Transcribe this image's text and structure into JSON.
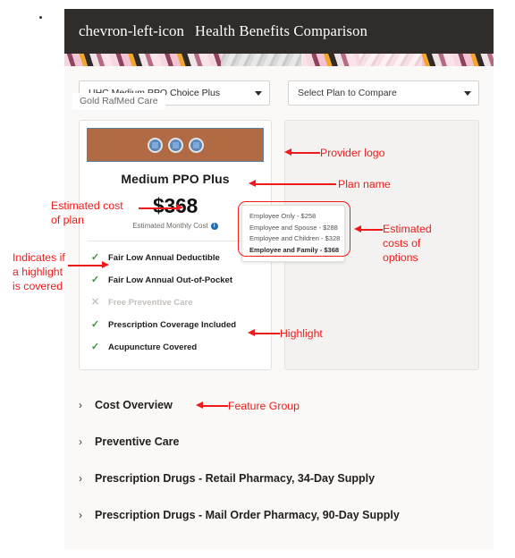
{
  "header": {
    "back_icon": "chevron-left-icon",
    "title": "Health Benefits Comparison"
  },
  "selectors": {
    "plan_select": {
      "value": "UHC Medium PPO Choice Plus",
      "tooltip": "Gold RafMed Care",
      "caret_icon": "chevron-down-icon"
    },
    "compare_select": {
      "placeholder": "Select Plan to Compare",
      "caret_icon": "chevron-down-icon"
    }
  },
  "plan_card": {
    "provider_logo_alt": "provider-logo",
    "plan_name": "Medium PPO Plus",
    "price": "$368",
    "price_caption": "Estimated Monthly Cost",
    "info_icon": "info-icon",
    "features": [
      {
        "label": "Fair Low Annual Deductible",
        "covered": true,
        "mark": "✓"
      },
      {
        "label": "Fair Low Annual Out-of-Pocket",
        "covered": true,
        "mark": "✓"
      },
      {
        "label": "Free Preventive Care",
        "covered": false,
        "mark": "✕"
      },
      {
        "label": "Prescription Coverage Included",
        "covered": true,
        "mark": "✓"
      },
      {
        "label": "Acupuncture Covered",
        "covered": true,
        "mark": "✓"
      }
    ]
  },
  "cost_popup": {
    "options": [
      {
        "label": "Employee Only - $258",
        "bold": false
      },
      {
        "label": "Employee and Spouse - $288",
        "bold": false
      },
      {
        "label": "Employee and Children - $328",
        "bold": false
      },
      {
        "label": "Employee and Family - $368",
        "bold": true
      }
    ]
  },
  "accordion": {
    "chevron_icon": "chevron-right-icon",
    "items": [
      {
        "label": "Cost Overview"
      },
      {
        "label": "Preventive Care"
      },
      {
        "label": "Prescription Drugs - Retail Pharmacy, 34-Day Supply"
      },
      {
        "label": "Prescription Drugs - Mail Order Pharmacy, 90-Day Supply"
      }
    ]
  },
  "annotations": {
    "color": "#f01a1a",
    "estimated_cost_of_plan": "Estimated cost\nof plan",
    "indicates_highlight_covered": "Indicates if\na highlight\nis covered",
    "provider_logo": "Provider logo",
    "plan_name": "Plan name",
    "estimated_costs_of_options": "Estimated\ncosts of\noptions",
    "highlight": "Highlight",
    "feature_group": "Feature Group"
  }
}
